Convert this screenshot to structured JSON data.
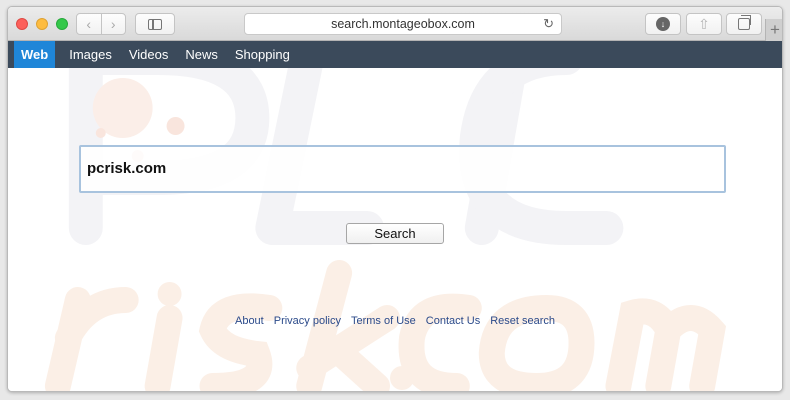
{
  "browser": {
    "url": "search.montageobox.com",
    "back_glyph": "‹",
    "forward_glyph": "›",
    "reload_glyph": "↻",
    "download_glyph": "↓",
    "share_glyph": "⇧",
    "newtab_glyph": "+"
  },
  "nav": {
    "items": [
      {
        "label": "Web",
        "active": true
      },
      {
        "label": "Images"
      },
      {
        "label": "Videos"
      },
      {
        "label": "News"
      },
      {
        "label": "Shopping"
      }
    ]
  },
  "search": {
    "value": "pcrisk.com",
    "button_label": "Search"
  },
  "footer": {
    "links": [
      "About",
      "Privacy policy",
      "Terms of Use",
      "Contact Us",
      "Reset search"
    ]
  },
  "colors": {
    "nav_bg": "#3b4a5b",
    "nav_active": "#1f86d8",
    "link": "#2b4a8a",
    "input_border": "#a8c3de"
  }
}
